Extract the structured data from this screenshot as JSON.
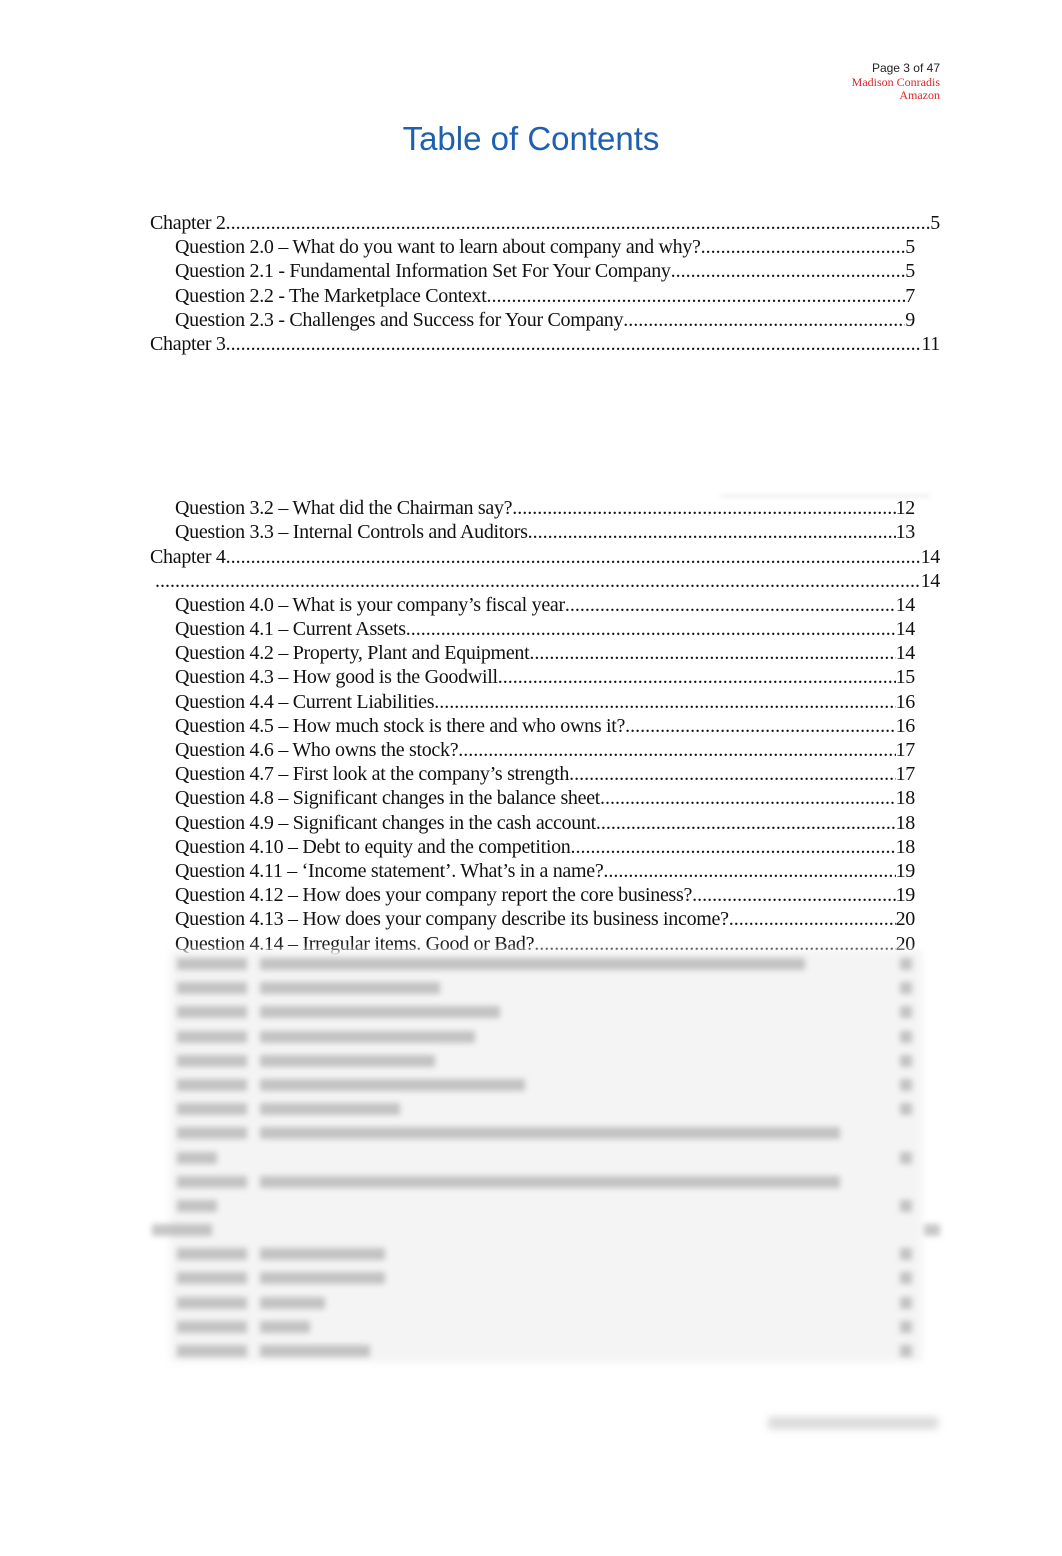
{
  "header": {
    "page_number": "Page 3 of 47",
    "author": "Madison Conradis",
    "company": "Amazon"
  },
  "title": "Table of Contents",
  "colors": {
    "title": "#1f5faf",
    "header_meta": "#d9262a",
    "text": "#111111"
  },
  "toc": {
    "section_a": [
      {
        "level": 1,
        "label": "Chapter 2",
        "page": "5"
      },
      {
        "level": 2,
        "label": "Question 2.0 – What do you want to learn about company and why?",
        "page": "5"
      },
      {
        "level": 2,
        "label": "Question 2.1 - Fundamental Information Set For Your Company",
        "page": "5"
      },
      {
        "level": 2,
        "label": "Question 2.2 - The Marketplace Context",
        "page": "7"
      },
      {
        "level": 2,
        "label": "Question 2.3 - Challenges and Success for Your Company",
        "page": "9"
      },
      {
        "level": 1,
        "label": "Chapter 3",
        "page": "11"
      }
    ],
    "section_b": [
      {
        "level": 2,
        "label": "Question 3.2 – What did the Chairman say?",
        "page": "12"
      },
      {
        "level": 2,
        "label": "Question 3.3 – Internal Controls and Auditors",
        "page": "13"
      },
      {
        "level": 1,
        "label": "Chapter 4",
        "page": "14"
      },
      {
        "level": 1,
        "label": "",
        "page": "14"
      },
      {
        "level": 2,
        "label": "Question 4.0 – What is your company’s fiscal year",
        "page": "14"
      },
      {
        "level": 2,
        "label": "Question 4.1 – Current Assets",
        "page": "14"
      },
      {
        "level": 2,
        "label": "Question 4.2 – Property, Plant and Equipment ",
        "page": "14"
      },
      {
        "level": 2,
        "label": "Question 4.3 – How good is the Goodwill ",
        "page": "15"
      },
      {
        "level": 2,
        "label": "Question 4.4 – Current Liabilities",
        "page": "16"
      },
      {
        "level": 2,
        "label": "Question 4.5 – How much stock is there and who owns it?",
        "page": "16"
      },
      {
        "level": 2,
        "label": "Question 4.6 – Who owns the stock?",
        "page": "17"
      },
      {
        "level": 2,
        "label": "Question 4.7 – First look at the company’s strength",
        "page": "17"
      },
      {
        "level": 2,
        "label": "Question 4.8 – Significant changes in the balance sheet",
        "page": "18"
      },
      {
        "level": 2,
        "label": "Question 4.9 – Significant changes in the cash account",
        "page": "18"
      },
      {
        "level": 2,
        "label": "Question 4.10 – Debt to equity and the competition",
        "page": "18"
      },
      {
        "level": 2,
        "label": "Question 4.11 – ‘Income statement’.  What’s in a name?",
        "page": "19"
      },
      {
        "level": 2,
        "label": "Question 4.12 – How does your company report the core business?",
        "page": "19"
      },
      {
        "level": 2,
        "label": "Question 4.13 – How does your company describe its business income?",
        "page": "20"
      },
      {
        "level": 2,
        "label": "Question 4.14 – Irregular items.  Good or Bad?",
        "page": "20"
      }
    ]
  }
}
